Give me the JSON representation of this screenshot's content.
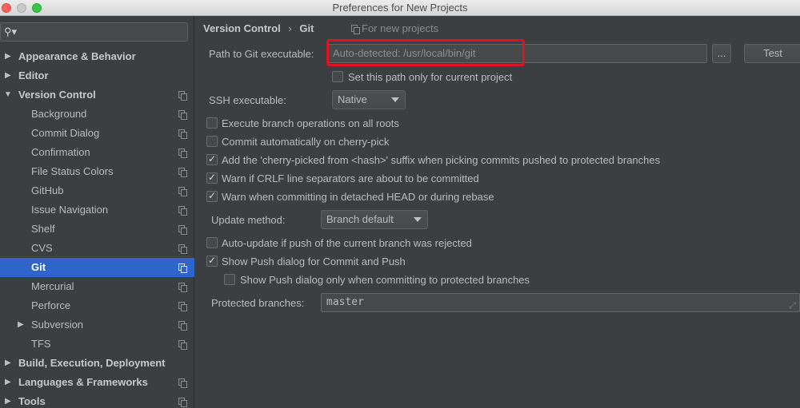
{
  "window": {
    "title": "Preferences for New Projects"
  },
  "search": {
    "placeholder": ""
  },
  "sidebar": {
    "items": [
      {
        "label": "Appearance & Behavior"
      },
      {
        "label": "Editor"
      },
      {
        "label": "Version Control"
      },
      {
        "label": "Background"
      },
      {
        "label": "Commit Dialog"
      },
      {
        "label": "Confirmation"
      },
      {
        "label": "File Status Colors"
      },
      {
        "label": "GitHub"
      },
      {
        "label": "Issue Navigation"
      },
      {
        "label": "Shelf"
      },
      {
        "label": "CVS"
      },
      {
        "label": "Git"
      },
      {
        "label": "Mercurial"
      },
      {
        "label": "Perforce"
      },
      {
        "label": "Subversion"
      },
      {
        "label": "TFS"
      },
      {
        "label": "Build, Execution, Deployment"
      },
      {
        "label": "Languages & Frameworks"
      },
      {
        "label": "Tools"
      }
    ],
    "selected": "Git"
  },
  "breadcrumb": {
    "parent": "Version Control",
    "separator": "›",
    "current": "Git",
    "scope": "For new projects"
  },
  "git_path": {
    "label": "Path to Git executable:",
    "value": "Auto-detected: /usr/local/bin/git",
    "browse_label": "...",
    "test_label": "Test",
    "current_project_only": {
      "label": "Set this path only for current project",
      "checked": false
    }
  },
  "ssh": {
    "label": "SSH executable:",
    "value": "Native"
  },
  "options": [
    {
      "label": "Execute branch operations on all roots",
      "checked": false
    },
    {
      "label": "Commit automatically on cherry-pick",
      "checked": false
    },
    {
      "label": "Add the 'cherry-picked from <hash>' suffix when picking commits pushed to protected branches",
      "checked": true
    },
    {
      "label": "Warn if CRLF line separators are about to be committed",
      "checked": true
    },
    {
      "label": "Warn when committing in detached HEAD or during rebase",
      "checked": true
    }
  ],
  "update_method": {
    "label": "Update method:",
    "value": "Branch default"
  },
  "push_options": [
    {
      "label": "Auto-update if push of the current branch was rejected",
      "checked": false
    },
    {
      "label": "Show Push dialog for Commit and Push",
      "checked": true
    },
    {
      "label": "Show Push dialog only when committing to protected branches",
      "checked": false
    }
  ],
  "protected_branches": {
    "label": "Protected branches:",
    "value": "master"
  },
  "colors": {
    "highlight": "#e0121d",
    "selection": "#2f65ca"
  },
  "icons": {
    "search": "search-icon",
    "settings_scope": "copy-icon",
    "expand": "expand-icon"
  }
}
